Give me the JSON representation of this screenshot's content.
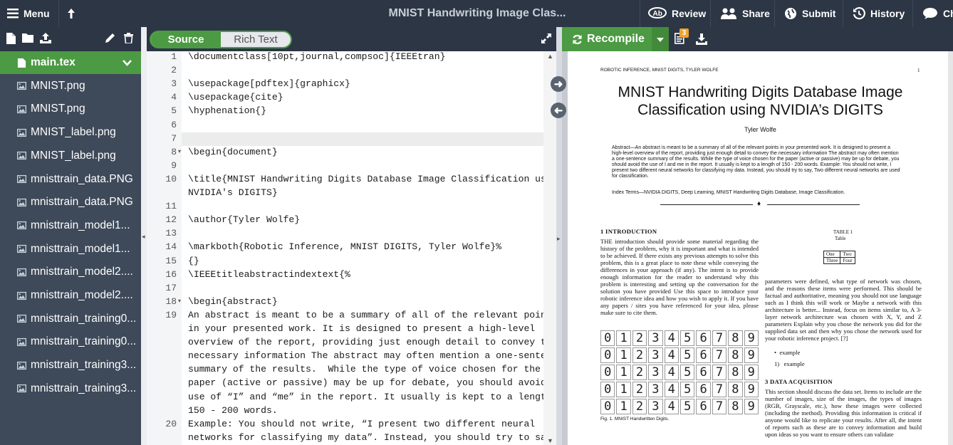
{
  "topbar": {
    "menu_label": "Menu",
    "title": "MNIST Handwriting Image Clas...",
    "review_label": "Review",
    "share_label": "Share",
    "submit_label": "Submit",
    "history_label": "History",
    "chat_label": "Ch"
  },
  "files": [
    {
      "name": "main.tex",
      "active": true
    },
    {
      "name": "MNIST.png"
    },
    {
      "name": "MNIST.png"
    },
    {
      "name": "MNIST_label.png"
    },
    {
      "name": "MNIST_label.png"
    },
    {
      "name": "mnisttrain_data.PNG"
    },
    {
      "name": "mnisttrain_data.PNG"
    },
    {
      "name": "mnisttrain_model1..."
    },
    {
      "name": "mnisttrain_model1..."
    },
    {
      "name": "mnisttrain_model2...."
    },
    {
      "name": "mnisttrain_model2...."
    },
    {
      "name": "mnisttrain_training0..."
    },
    {
      "name": "mnisttrain_training0..."
    },
    {
      "name": "mnisttrain_training3..."
    },
    {
      "name": "mnisttrain_training3..."
    }
  ],
  "editor": {
    "source_label": "Source",
    "rich_text_label": "Rich Text",
    "lines": [
      {
        "n": "1",
        "text": "\\documentclass[10pt,journal,compsoc]{IEEEtran}"
      },
      {
        "n": "2",
        "text": ""
      },
      {
        "n": "3",
        "text": "\\usepackage[pdftex]{graphicx}"
      },
      {
        "n": "4",
        "text": "\\usepackage{cite}"
      },
      {
        "n": "5",
        "text": "\\hyphenation{}"
      },
      {
        "n": "6",
        "text": ""
      },
      {
        "n": "7",
        "text": ""
      },
      {
        "n": "8",
        "text": "\\begin{document}"
      },
      {
        "n": "9",
        "text": ""
      },
      {
        "n": "10",
        "text": "\\title{MNIST Handwriting Digits Database Image Classification using"
      },
      {
        "n": "",
        "text": "NVIDIA's DIGITS}"
      },
      {
        "n": "11",
        "text": ""
      },
      {
        "n": "12",
        "text": "\\author{Tyler Wolfe}"
      },
      {
        "n": "13",
        "text": ""
      },
      {
        "n": "14",
        "text": "\\markboth{Robotic Inference, MNIST DIGITS, Tyler Wolfe}%"
      },
      {
        "n": "15",
        "text": "{}"
      },
      {
        "n": "16",
        "text": "\\IEEEtitleabstractindextext{%"
      },
      {
        "n": "17",
        "text": ""
      },
      {
        "n": "18",
        "text": "\\begin{abstract}"
      },
      {
        "n": "19",
        "text": "An abstract is meant to be a summary of all of the relevant points"
      },
      {
        "n": "",
        "text": "in your presented work. It is designed to present a high-level"
      },
      {
        "n": "",
        "text": "overview of the report, providing just enough detail to convey the"
      },
      {
        "n": "",
        "text": "necessary information The abstract may often mention a one-sentence"
      },
      {
        "n": "",
        "text": "summary of the results.  While the type of voice chosen for the"
      },
      {
        "n": "",
        "text": "paper (active or passive) may be up for debate, you should avoid the"
      },
      {
        "n": "",
        "text": "use of “I” and “me” in the report. It usually is kept to a length of"
      },
      {
        "n": "",
        "text": "150 - 200 words."
      },
      {
        "n": "20",
        "text": "Example: You should not write, “I present two different neural"
      },
      {
        "n": "",
        "text": "networks for classifying my data”. Instead, you should try to say,"
      }
    ]
  },
  "pdf": {
    "recompile_label": "Recompile",
    "log_badge": "3",
    "running_header": "ROBOTIC INFERENCE, MNIST DIGITS, TYLER WOLFE",
    "page_number": "1",
    "title_line1": "MNIST Handwriting Digits Database Image",
    "title_line2": "Classification using NVIDIA’s DIGITS",
    "author": "Tyler Wolfe",
    "abstract": "Abstract—An abstract is meant to be a summary of all of the relevant points in your presented work. It is designed to present a high-level overview of the report, providing just enough detail to convey the necessary information The abstract may often mention a one-sentence summary of the results. While the type of voice chosen for the paper (active or passive) may be up for debate, you should avoid the use of I and me in the report. It usually is kept to a length of 150 - 200 words. Example: You should not write, I present two different neural networks for classifying my data. Instead, you should try to say, Two different neural networks are used for classification.",
    "index_terms": "Index Terms—NVIDIA DIGITS, Deep Learning, MNIST Handwriting Digits Database, Image Classification.",
    "sec1_heading": "1   INTRODUCTION",
    "sec1_text": "THE introduction should provide some material regarding the history of the problem, why it is important and what is intended to be achieved. If there exists any previous attempts to solve this problem, this is a great place to note these while conveying the differences in your approach (if any). The intent is to provide enough information for the reader to understand why this problem is interesting and setting up the conversation for the solution you have provided Use this space to introduce your robotic inference idea and how you wish to apply it. If you have any papers / sites you have referenced for your idea, please make sure to cite them.",
    "table_caption": "TABLE 1",
    "table_title": "Table",
    "table_cells": [
      "One",
      "Two",
      "Three",
      "Four"
    ],
    "col2_text": "parameters were defined, what type of network was chosen, and the reasons these items were performed. This should be factual and authoritative, meaning you should not use language such as I think this will work or Maybe a network with this architecture is better... Instead, focus on items similar to, A 3-layer network architecture was chosen with X, Y, and Z parameters Explain why you chose the network you did for the supplied data set and then why you chose the network used for your robotic inference project. [?]",
    "bullet_item": "example",
    "numbered_item": "example",
    "sec3_heading": "3   DATA ACQUISITION",
    "sec3_text": "This section should discuss the data set. Items to include are the number of images, size of the images, the types of images (RGB, Grayscale, etc.), how these images were collected (including the method). Providing this information is critical if anyone would like to replicate your results. After all, the intent of reports such as these are to convey information and build upon ideas so you want to ensure others can validate",
    "fig_caption": "Fig. 1. MNIST Handwritten Digits.",
    "digits": [
      "0",
      "1",
      "2",
      "3",
      "4",
      "5",
      "6",
      "7",
      "8",
      "9"
    ]
  }
}
